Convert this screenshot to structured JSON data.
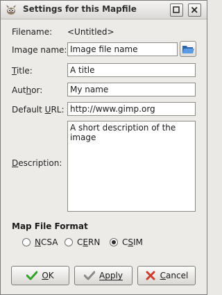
{
  "window": {
    "title": "Settings for this Mapfile",
    "buttons": [
      "maximize",
      "close"
    ]
  },
  "form": {
    "filename_label": "Filename:",
    "filename_value": "<Untitled>",
    "image_name_label": "Image name:",
    "image_name_value": "Image file name",
    "title_label_prefix": "T",
    "title_label_rest": "itle:",
    "title_value": "A title",
    "author_label_prefix": "Aut",
    "author_label_mnemonic": "h",
    "author_label_rest": "or:",
    "author_value": "My name",
    "url_label_prefix": "Default ",
    "url_label_mnemonic": "U",
    "url_label_rest": "RL:",
    "url_value": "http://www.gimp.org",
    "description_label_mnemonic": "D",
    "description_label_rest": "escription:",
    "description_value": "A short description of the image"
  },
  "format": {
    "section_label": "Map File Format",
    "options": [
      {
        "label_mnemonic": "N",
        "label_rest": "CSA",
        "checked": false
      },
      {
        "label_prefix": "C",
        "label_mnemonic": "E",
        "label_rest": "RN",
        "checked": false
      },
      {
        "label_prefix": "C",
        "label_mnemonic": "S",
        "label_rest": "IM",
        "checked": true
      }
    ]
  },
  "actions": {
    "ok_mnemonic": "O",
    "ok_rest": "K",
    "apply_prefix": "Apply",
    "cancel_mnemonic": "C",
    "cancel_rest": "ancel"
  },
  "colors": {
    "ok_check": "#2fa32a",
    "apply_check": "#8a8a8a",
    "cancel_x": "#d13b2c",
    "folder_blue": "#3c7fd0"
  }
}
